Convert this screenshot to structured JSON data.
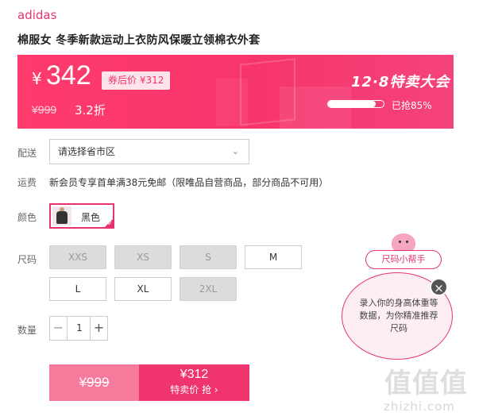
{
  "product": {
    "brand": "adidas",
    "title": "棉服女 冬季新款运动上衣防风保暖立领棉衣外套"
  },
  "banner": {
    "currency": "¥",
    "price": "342",
    "coupon_price": "券后价 ¥312",
    "original_price": "¥999",
    "discount": "3.2折",
    "sale_name": "12·8特卖大会",
    "progress_label": "已抢85%",
    "progress_fraction": 0.85
  },
  "delivery": {
    "label": "配送",
    "select_value": "请选择省市区"
  },
  "shipping": {
    "label": "运费",
    "text": "新会员专享首单满38元免邮（限唯品自营商品，部分商品不可用）"
  },
  "color": {
    "label": "颜色",
    "options": [
      {
        "label": "黑色",
        "selected": true
      }
    ]
  },
  "size": {
    "label": "尺码",
    "options": [
      {
        "label": "XXS",
        "available": false
      },
      {
        "label": "XS",
        "available": false
      },
      {
        "label": "S",
        "available": false
      },
      {
        "label": "M",
        "available": true
      },
      {
        "label": "L",
        "available": true
      },
      {
        "label": "XL",
        "available": true
      },
      {
        "label": "2XL",
        "available": false
      }
    ]
  },
  "quantity": {
    "label": "数量",
    "value": "1",
    "minus": "−",
    "plus": "+"
  },
  "buy": {
    "original_price": "¥999",
    "sale_price": "¥312",
    "action_label": "特卖价 抢 ›"
  },
  "helper": {
    "tag": "尺码小帮手",
    "bubble_text": "录入你的身高体重等数据，为你精准推荐尺码",
    "close_glyph": "×"
  },
  "watermark": {
    "chars": "值值值",
    "url": "zhizhi.com"
  },
  "colors": {
    "accent": "#e6336e",
    "banner": "#f7356d",
    "buy_left": "#f7799c",
    "buy_right": "#f0346d",
    "disabled": "#dcdcdc"
  },
  "icons": {
    "select_arrow": "chevron-down-icon",
    "check": "check-icon",
    "close": "close-icon"
  }
}
